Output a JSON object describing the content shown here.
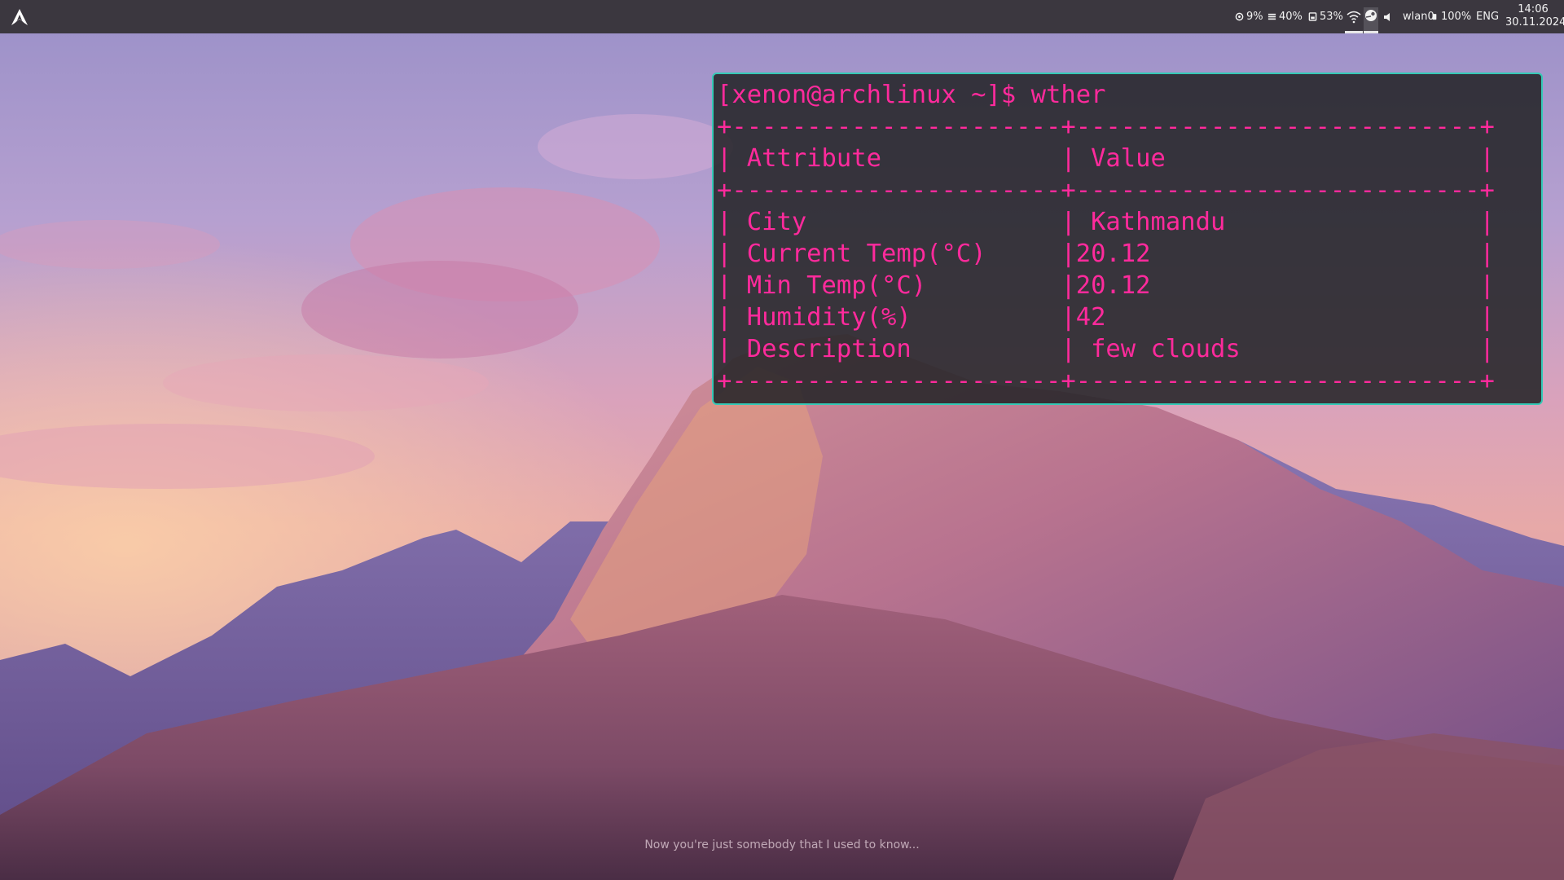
{
  "topbar": {
    "cpu_label": "9%",
    "memory_label": "40%",
    "disk_label": "53%",
    "network_label": "wlan0",
    "battery_label": "100%",
    "language_label": "ENG",
    "clock_time": "14:06",
    "clock_date": "30.11.2024"
  },
  "terminal": {
    "prompt": "[xenon@archlinux ~]$ wther",
    "border_line": "+----------------------+---------------------------+",
    "header_row": "| Attribute            | Value                     |",
    "rows": [
      "| City                 | Kathmandu                 |",
      "| Current Temp(°C)     |20.12                      |",
      "| Min Temp(°C)         |20.12                      |",
      "| Humidity(%)          |42                         |",
      "| Description          | few clouds                |"
    ]
  },
  "lyrics": "Now you're just somebody that I used to know...",
  "colors": {
    "terminal_text": "#ff2a9c",
    "terminal_border": "#35c9b6",
    "terminal_bg": "#252528",
    "topbar_bg": "#3b373f"
  }
}
